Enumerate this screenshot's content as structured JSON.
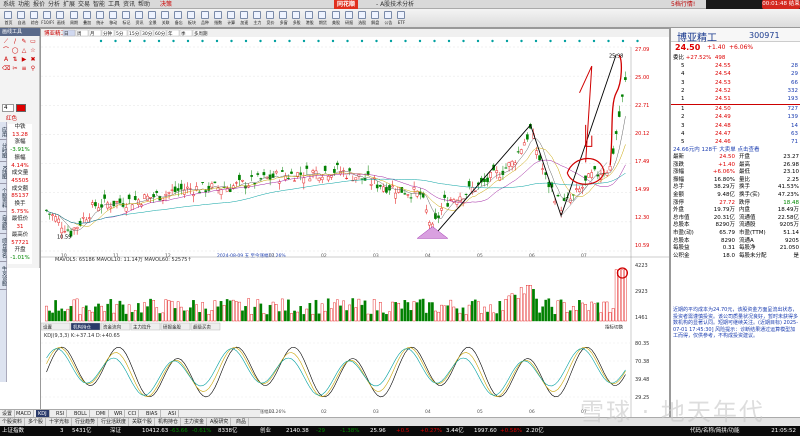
{
  "app": {
    "title": "同花顺",
    "subtitle": "- A股技术分析",
    "promo": "5档行情!",
    "clock": "00:01:48 结束"
  },
  "menu": [
    "系统",
    "功能",
    "报价",
    "分析",
    "扩展",
    "交易",
    "智能",
    "工具",
    "资讯",
    "帮助"
  ],
  "menu_extra": "决策",
  "toolbar": [
    "首页",
    "自选",
    "综合",
    "F10/F9",
    "画线",
    "周期",
    "叠加",
    "统计",
    "移动",
    "标记",
    "资讯",
    "全景",
    "关联",
    "备忘",
    "板块",
    "品种",
    "指数",
    "计算",
    "加速",
    "主力",
    "竞价",
    "多窗",
    "多股",
    "港股",
    "期货",
    "美股",
    "研报",
    "选股",
    "解盘",
    "公告",
    "ETF"
  ],
  "drawbar": {
    "title": "画线工具",
    "tools": [
      "⟋",
      "/",
      "✎",
      "▭",
      "⌒",
      "◯",
      "△",
      "☆",
      "A",
      "⇅",
      "▶",
      "✖",
      "⌫",
      "✂",
      "≡",
      "⚲"
    ],
    "color_label": "红色",
    "size": "4"
  },
  "strip_tabs": [
    "应用",
    "分时图",
    "K线图",
    "个股资料",
    "自选股",
    "综合排名",
    "牛叉诊股"
  ],
  "left_quote": [
    "中铁",
    "13.28",
    "涨幅",
    "-3.91%",
    "振幅",
    "4.14%",
    "成交量",
    "45505",
    "成交额",
    "85137",
    "换手",
    "5.75%",
    "最低价",
    "31",
    "最高价",
    "57721",
    "开盘",
    "-1.01%"
  ],
  "chart_header": {
    "name": "博亚精工",
    "periods": [
      "日",
      "周",
      "月",
      "分钟",
      "5分",
      "15分",
      "30分",
      "60分",
      "年",
      "季",
      "多周期"
    ],
    "values": [
      "前复权",
      "不复权"
    ]
  },
  "volume_legend": "MAVOL5: 65186  MAVOL10: 11.14万  MAVOL60: 52575↑",
  "kdj_legend": "KDJ(9,3,3)  K:+37.14  D:+40.65",
  "kdj_right": [
    "80.35",
    "70.38",
    "39.48",
    "29.25"
  ],
  "price_labels": [
    "27.09",
    "25.00",
    "22.71",
    "20.12",
    "17.49",
    "14.99",
    "12.30",
    "10.59"
  ],
  "price_high": "25.98",
  "price_low": "10.59",
  "vol_labels": [
    "4223",
    "2923",
    "1461"
  ],
  "date_labels": [
    "10",
    "11",
    "12",
    "2024-08-09 五 至今涨幅17.26%",
    "01",
    "02",
    "03",
    "04",
    "05",
    "06",
    "07"
  ],
  "sub_tabs": [
    "设置",
    "机构持仓",
    "资金流向",
    "主力拉升",
    "研报金股",
    "超级买卖"
  ],
  "ind_tabs": [
    "设置",
    "MACD",
    "KDJ",
    "RSI",
    "BOLL",
    "DMI",
    "WR",
    "CCI",
    "BIAS",
    "ASI"
  ],
  "ind_right": "指标切换",
  "func_tabs": [
    "个股资料",
    "多个股",
    "十字光标",
    "行业趋势",
    "行业活跃度",
    "关联个股",
    "机构持仓",
    "主力资金",
    "A股研究",
    "商品"
  ],
  "stock": {
    "name": "博亚精工",
    "code": "300971",
    "price": "24.50",
    "change": "+1.40",
    "pct": "+6.06%",
    "weibi": "+27.52%",
    "weicha": "498",
    "orders_sell": [
      [
        "5",
        "24.55",
        "28"
      ],
      [
        "4",
        "24.54",
        "29"
      ],
      [
        "3",
        "24.53",
        "66"
      ],
      [
        "2",
        "24.52",
        "332"
      ],
      [
        "1",
        "24.51",
        "193"
      ]
    ],
    "orders_buy": [
      [
        "1",
        "24.50",
        "727"
      ],
      [
        "2",
        "24.49",
        "139"
      ],
      [
        "3",
        "24.48",
        "14"
      ],
      [
        "4",
        "24.47",
        "63"
      ],
      [
        "5",
        "24.46",
        "71"
      ]
    ],
    "rank_line": "24.66元内 128千 大卖单 点击查看",
    "stats": [
      [
        "最新",
        "24.50",
        "开盘",
        "23.27"
      ],
      [
        "涨跌",
        "+1.40",
        "最高",
        "26.98"
      ],
      [
        "涨幅",
        "+6.06%",
        "最低",
        "23.10"
      ],
      [
        "振幅",
        "16.80%",
        "量比",
        "2.25"
      ],
      [
        "总手",
        "38.29万",
        "换手",
        "41.53%"
      ],
      [
        "金额",
        "9.48亿",
        "换手(实)",
        "47.23%"
      ],
      [
        "涨停",
        "27.72",
        "跌停",
        "18.48"
      ],
      [
        "外盘",
        "19.79万",
        "内盘",
        "18.49万"
      ],
      [
        "总市值",
        "20.31亿",
        "流通值",
        "22.58亿"
      ],
      [
        "总股本",
        "8290万",
        "流通股",
        "9205万"
      ],
      [
        "市盈(动)",
        "65.79",
        "市盈(TTM)",
        "51.14"
      ],
      [
        "总股本",
        "8290",
        "流通A",
        "9205"
      ],
      [
        "每股益",
        "0.31",
        "每股净",
        "21.050"
      ],
      [
        "公积金",
        "18.0",
        "每股未分配",
        "是"
      ]
    ],
    "note": "近期的平均成本为24.70元，该股资金方面呈流出状态，投资者需谨慎投资。该公司质量状况良好，暂时未获得多数机构的显著认同。短期可继续关注。(近期目标) 2025-07-01 17:45:30] 风险提示：诊断结果通过运算模型加工而得，仅供参考，不构成投资建议。"
  },
  "ticker": {
    "items": [
      "上证指数",
      "3",
      "5431亿",
      "深证",
      "10412.63",
      "-63.66",
      "-0.61%",
      "8338亿",
      "创业",
      "2140.38",
      "-29",
      "-1.38%",
      "25.96",
      "+0.5",
      "+0.27%",
      "3.44亿",
      "1997.60",
      "+0.58%",
      "2.20亿",
      "代码/名称/简拼/功能"
    ],
    "time": "21:05:52"
  },
  "watermark": "雪球 · 地天年代",
  "colors": {
    "up": "#e00000",
    "down": "#008000",
    "trendline": "#000000",
    "annotation": "#d00000",
    "volume_spike": "#e00000"
  }
}
